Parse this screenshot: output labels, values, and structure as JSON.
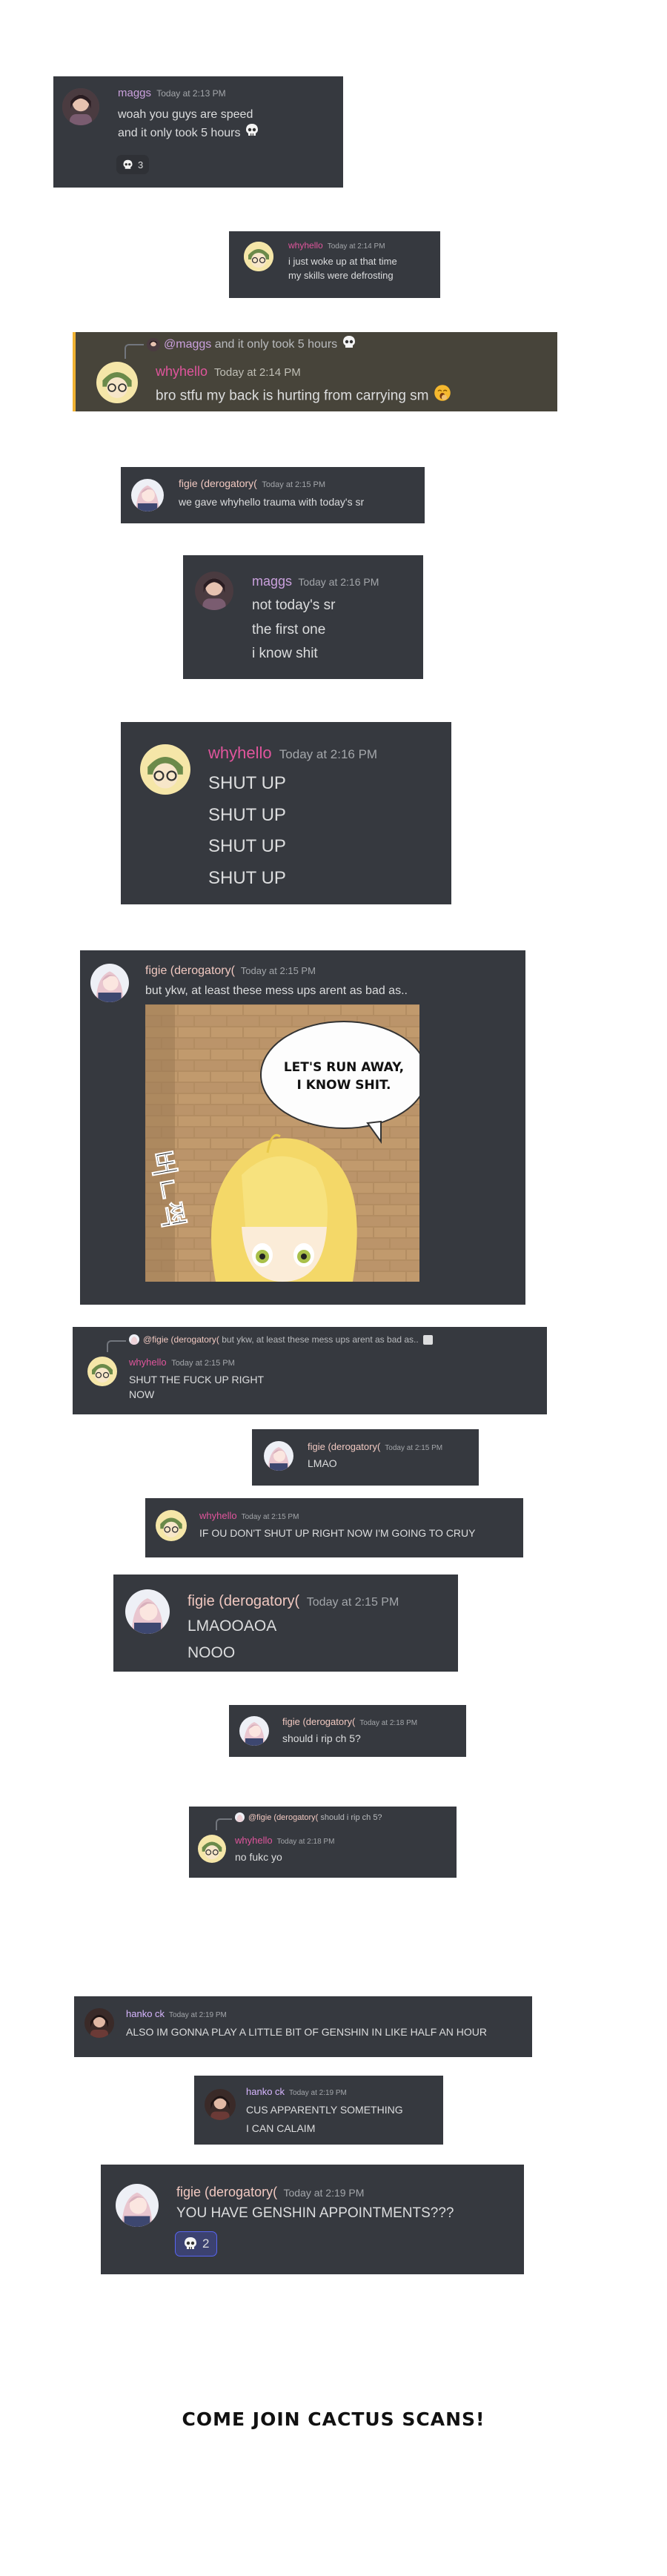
{
  "users": {
    "maggs": "maggs",
    "whyhello": "whyhello",
    "figie": "figie (derogatory(",
    "hanko": "hanko ck"
  },
  "colors": {
    "card_bg": "#36393f",
    "highlight_bg": "#47443a",
    "highlight_bar": "#f0b232",
    "timestamp": "#a3a6aa",
    "text": "#dcddde",
    "maggs": "#c9a0dc",
    "whyhello": "#e0559c",
    "figie": "#f0c8c0",
    "hanko": "#d7b6ff",
    "reaction_active": "#5865f2"
  },
  "messages": [
    {
      "id": "m1",
      "author": "maggs",
      "timestamp": "Today at 2:13 PM",
      "lines": [
        "woah you guys are speed",
        "and it only took 5 hours"
      ],
      "inline_icon": "skull-icon",
      "reaction": {
        "icon": "skull-icon",
        "count": "3"
      }
    },
    {
      "id": "m2",
      "author": "whyhello",
      "timestamp": "Today at 2:14 PM",
      "lines": [
        "i just woke up at that time",
        "my skills were defrosting"
      ]
    },
    {
      "id": "m3",
      "author": "whyhello",
      "timestamp": "Today at 2:14 PM",
      "reply_to": {
        "mention": "@maggs",
        "text": "and it only took 5 hours"
      },
      "lines": [
        "bro stfu my back is hurting from carrying sm"
      ],
      "inline_icon": "yawning-face-icon"
    },
    {
      "id": "m4",
      "author": "figie (derogatory(",
      "timestamp": "Today at 2:15 PM",
      "lines": [
        "we gave whyhello trauma with today's sr"
      ]
    },
    {
      "id": "m5",
      "author": "maggs",
      "timestamp": "Today at 2:16 PM",
      "lines": [
        "not today's sr",
        "the first one",
        "i know shit"
      ]
    },
    {
      "id": "m6",
      "author": "whyhello",
      "timestamp": "Today at 2:16 PM",
      "lines": [
        "SHUT UP",
        "SHUT UP",
        "SHUT UP",
        "SHUT UP"
      ]
    },
    {
      "id": "m7",
      "author": "figie (derogatory(",
      "timestamp": "Today at 2:15 PM",
      "lines": [
        "but ykw, at least these mess ups arent as bad as.."
      ],
      "attachment": {
        "speech": [
          "LET'S RUN AWAY,",
          "I KNOW SHIT."
        ],
        "sfx": "버ㄴ쩍"
      }
    },
    {
      "id": "m8",
      "author": "whyhello",
      "timestamp": "Today at 2:15 PM",
      "reply_to": {
        "mention": "@figie (derogatory(",
        "text": "but ykw, at least these mess ups arent as bad as.."
      },
      "lines": [
        "SHUT THE FUCK UP RIGHT",
        "NOW"
      ]
    },
    {
      "id": "m9",
      "author": "figie (derogatory(",
      "timestamp": "Today at 2:15 PM",
      "lines": [
        "LMAO"
      ]
    },
    {
      "id": "m10",
      "author": "whyhello",
      "timestamp": "Today at 2:15 PM",
      "lines": [
        "IF OU DON'T SHUT UP RIGHT NOW I'M GOING TO CRUY"
      ]
    },
    {
      "id": "m11",
      "author": "figie (derogatory(",
      "timestamp": "Today at 2:15 PM",
      "lines": [
        "LMAOOAOA",
        "NOOO"
      ]
    },
    {
      "id": "m12",
      "author": "figie (derogatory(",
      "timestamp": "Today at 2:18 PM",
      "lines": [
        "should i rip ch 5?"
      ]
    },
    {
      "id": "m13",
      "author": "whyhello",
      "timestamp": "Today at 2:18 PM",
      "reply_to": {
        "mention": "@figie (derogatory(",
        "text": "should i rip ch 5?"
      },
      "lines": [
        "no fukc yo"
      ]
    },
    {
      "id": "m14",
      "author": "hanko ck",
      "timestamp": "Today at 2:19 PM",
      "lines": [
        "ALSO IM GONNA PLAY A LITTLE BIT OF GENSHIN IN LIKE HALF AN HOUR"
      ]
    },
    {
      "id": "m15",
      "author": "hanko ck",
      "timestamp": "Today at 2:19 PM",
      "lines": [
        "CUS APPARENTLY SOMETHING",
        "I CAN CALAIM"
      ]
    },
    {
      "id": "m16",
      "author": "figie (derogatory(",
      "timestamp": "Today at 2:19 PM",
      "lines": [
        "YOU HAVE GENSHIN APPOINTMENTS???"
      ],
      "reaction": {
        "icon": "skull-icon",
        "count": "2"
      }
    }
  ],
  "footer": "COME JOIN CACTUS SCANS!"
}
